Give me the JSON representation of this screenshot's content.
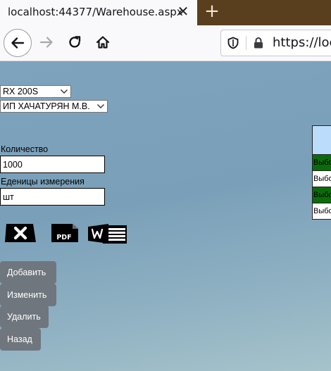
{
  "browser": {
    "tab_title": "localhost:44377/Warehouse.aspx",
    "tab_close_glyph": "✕",
    "new_tab_glyph": "+",
    "url_text": "https://loca",
    "icons": [
      "back-arrow-icon",
      "forward-arrow-icon",
      "reload-icon",
      "home-icon",
      "shield-icon",
      "lock-icon"
    ]
  },
  "form": {
    "model_select": {
      "value": "RX 200S"
    },
    "supplier_select": {
      "value": "ИП ХАЧАТУРЯН М.В."
    },
    "quantity": {
      "label": "Количество",
      "value": "1000"
    },
    "unit": {
      "label": "Еденицы измерения",
      "value": "шт"
    }
  },
  "export": {
    "icons": [
      "excel-icon",
      "pdf-icon",
      "word-icon"
    ],
    "pdf_text": "PDF"
  },
  "actions": {
    "add": "Добавить",
    "edit": "Изменить",
    "delete": "Удалить",
    "back": "Назад"
  },
  "grid": {
    "rows": [
      "Выбо",
      "Выбо",
      "Выбо",
      "Выбо"
    ],
    "colors": {
      "header": "#bcdcfb",
      "selected_row": "#0b6b0b"
    }
  }
}
